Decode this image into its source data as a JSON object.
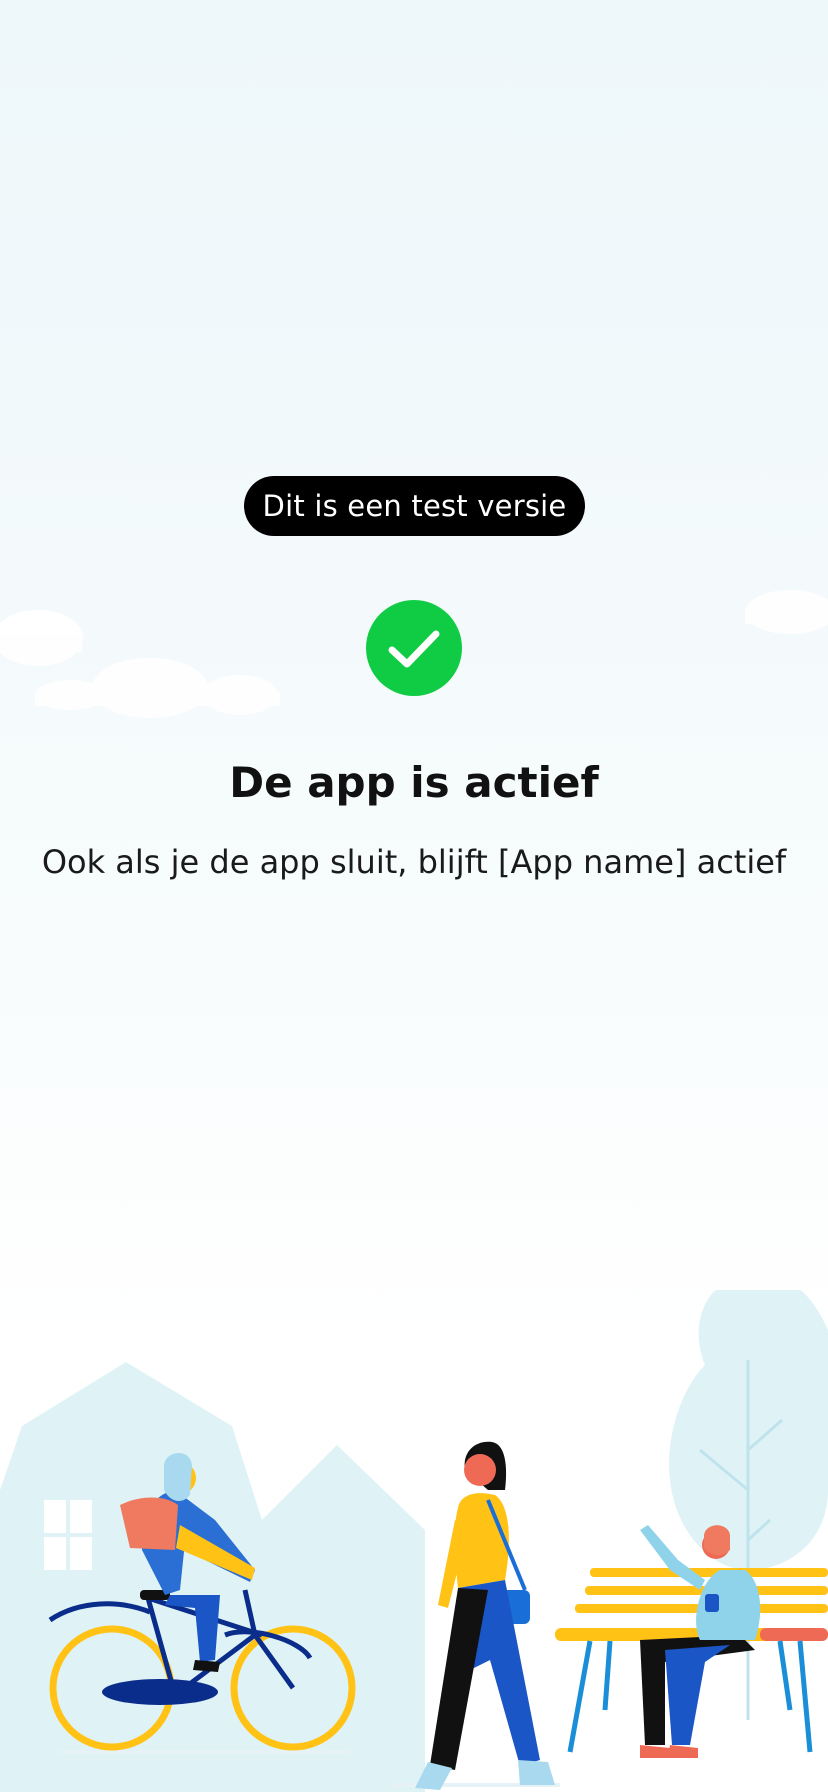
{
  "status_pill": {
    "label": "Dit is een test versie"
  },
  "status": {
    "icon": "checkmark-circle-icon",
    "color": "#10CC44",
    "title": "De app is actief",
    "subtitle": "Ook als je de app sluit, blijft [App name] actief"
  },
  "illustration": {
    "description_icons": [
      "cloud-icon",
      "house-icon",
      "tree-icon",
      "cyclist-figure",
      "walking-woman-figure",
      "bench-man-figure"
    ]
  }
}
